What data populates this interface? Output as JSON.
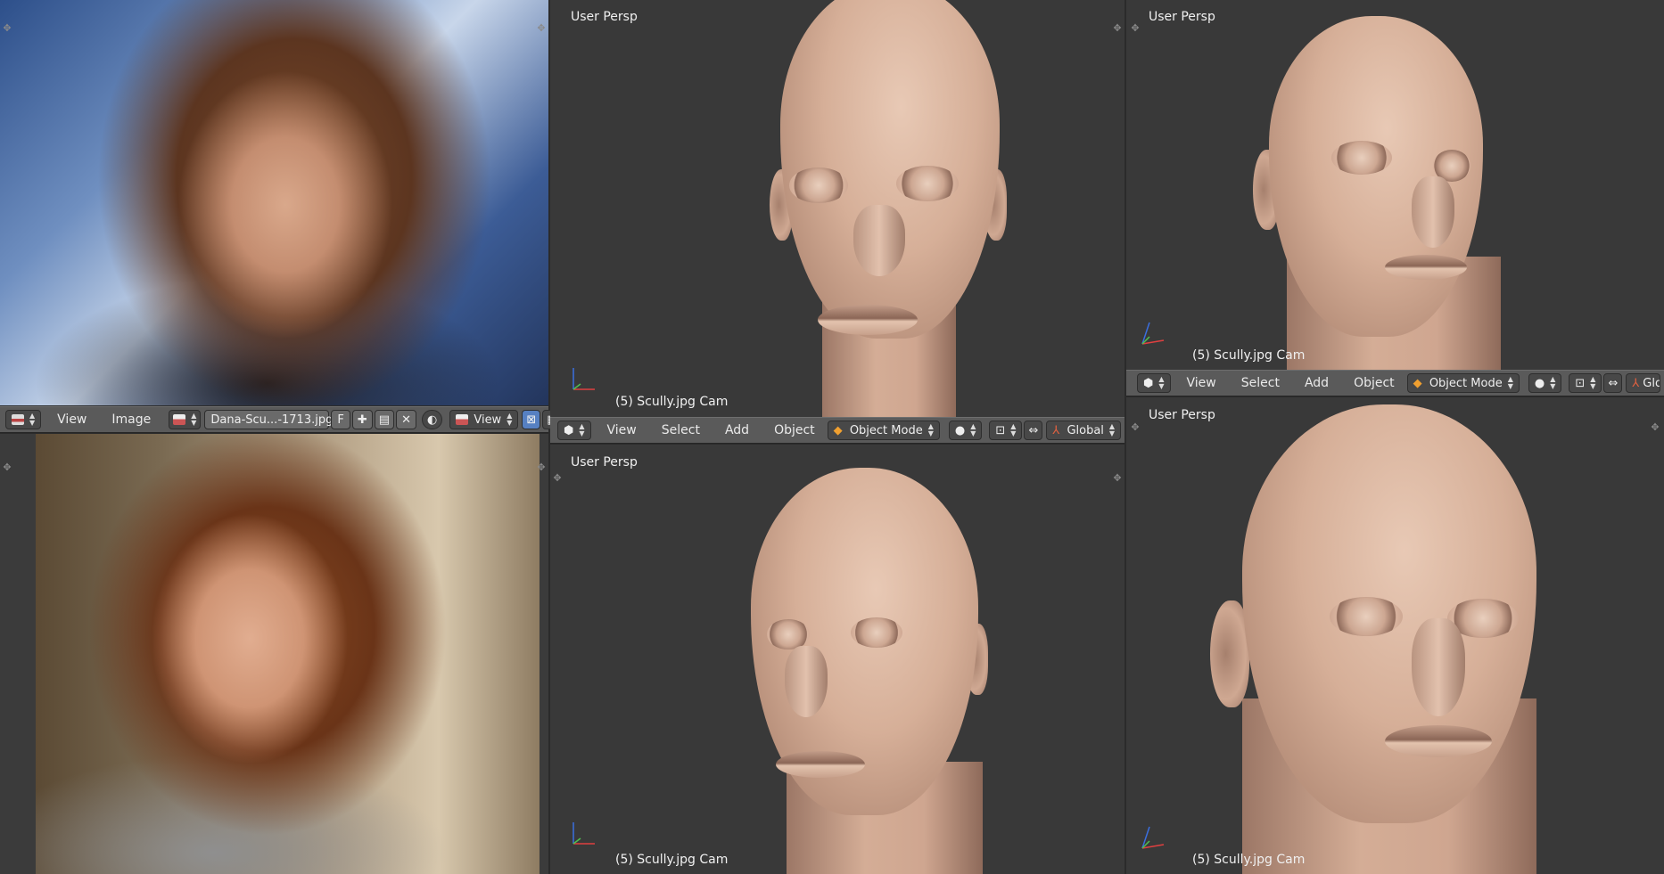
{
  "image_editor": {
    "menus": [
      "View",
      "Image"
    ],
    "image_name": "Dana-Scu...-1713.jpg",
    "fake_user_label": "F",
    "view_dropdown": "View"
  },
  "viewports": {
    "top_middle": {
      "persp_label": "User Persp",
      "object_label": "(5) Scully.jpg Cam"
    },
    "top_right": {
      "persp_label": "User Persp",
      "object_label": "(5) Scully.jpg Cam"
    },
    "bottom_middle": {
      "persp_label": "User Persp",
      "object_label": "(5) Scully.jpg Cam"
    },
    "bottom_right": {
      "persp_label": "User Persp",
      "object_label": "(5) Scully.jpg Cam"
    }
  },
  "view3d_header_mid": {
    "menus": [
      "View",
      "Select",
      "Add",
      "Object"
    ],
    "mode": "Object Mode",
    "orientation": "Global"
  },
  "view3d_header_right": {
    "menus": [
      "View",
      "Select",
      "Add",
      "Object"
    ],
    "mode": "Object Mode",
    "orientation": "Globa"
  },
  "colors": {
    "viewport_bg": "#393939",
    "header_bg": "#5a5a5a",
    "accent_blue": "#5680c2",
    "skin": "#d6af98"
  }
}
